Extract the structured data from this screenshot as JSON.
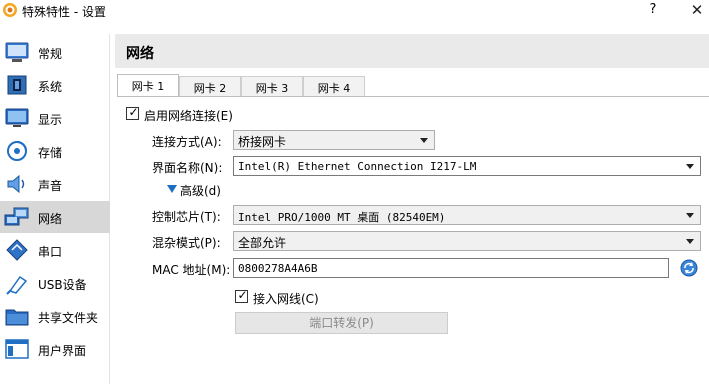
{
  "window": {
    "title": "特殊特性 - 设置",
    "help_label": "?",
    "close_label": "✕"
  },
  "sidebar": {
    "items": [
      {
        "label": "常规",
        "icon": "general-icon",
        "active": false
      },
      {
        "label": "系统",
        "icon": "system-icon",
        "active": false
      },
      {
        "label": "显示",
        "icon": "display-icon",
        "active": false
      },
      {
        "label": "存储",
        "icon": "storage-icon",
        "active": false
      },
      {
        "label": "声音",
        "icon": "audio-icon",
        "active": false
      },
      {
        "label": "网络",
        "icon": "network-icon",
        "active": true
      },
      {
        "label": "串口",
        "icon": "serial-port-icon",
        "active": false
      },
      {
        "label": "USB设备",
        "icon": "usb-icon",
        "active": false
      },
      {
        "label": "共享文件夹",
        "icon": "shared-folder-icon",
        "active": false
      },
      {
        "label": "用户界面",
        "icon": "user-interface-icon",
        "active": false
      }
    ]
  },
  "main": {
    "section_title": "网络",
    "tabs": [
      {
        "label": "网卡 1",
        "active": true
      },
      {
        "label": "网卡 2",
        "active": false
      },
      {
        "label": "网卡 3",
        "active": false
      },
      {
        "label": "网卡 4",
        "active": false
      }
    ],
    "enable_adapter": {
      "label": "启用网络连接(E)",
      "checked": true
    },
    "attached_to": {
      "label": "连接方式(A):",
      "value": "桥接网卡"
    },
    "interface_name": {
      "label": "界面名称(N):",
      "value": "Intel(R) Ethernet Connection I217-LM"
    },
    "advanced": {
      "label": "高级(d)",
      "expanded": true
    },
    "adapter_type": {
      "label": "控制芯片(T):",
      "value": "Intel PRO/1000 MT 桌面 (82540EM)"
    },
    "promiscuous": {
      "label": "混杂模式(P):",
      "value": "全部允许"
    },
    "mac_address": {
      "label": "MAC 地址(M):",
      "value": "0800278A4A6B"
    },
    "cable_connected": {
      "label": "接入网线(C)",
      "checked": true
    },
    "port_forwarding": {
      "label": "端口转发(P)",
      "enabled": false
    }
  },
  "colors": {
    "accent_blue": "#1f6fc5",
    "active_sidebar": "#d7d7d7",
    "header_bg": "#eaeaea"
  }
}
